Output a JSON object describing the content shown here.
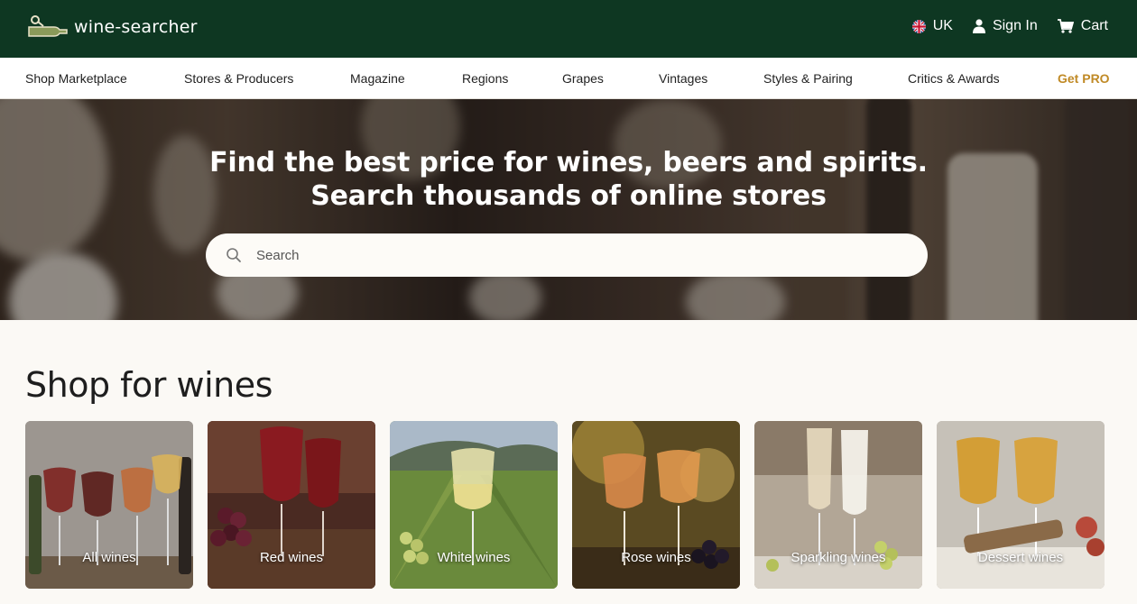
{
  "header": {
    "logo_text": "wine-searcher",
    "region": "UK",
    "sign_in": "Sign In",
    "cart": "Cart"
  },
  "nav": {
    "items": [
      {
        "label": "Shop Marketplace"
      },
      {
        "label": "Stores & Producers"
      },
      {
        "label": "Magazine"
      },
      {
        "label": "Regions"
      },
      {
        "label": "Grapes"
      },
      {
        "label": "Vintages"
      },
      {
        "label": "Styles & Pairing"
      },
      {
        "label": "Critics & Awards"
      },
      {
        "label": "Get PRO"
      }
    ]
  },
  "hero": {
    "line1": "Find the best price for wines, beers and spirits.",
    "line2": "Search thousands of online stores",
    "search_placeholder": "Search"
  },
  "section": {
    "title": "Shop for wines",
    "cards": [
      {
        "label": "All wines",
        "bg": "#8a8580"
      },
      {
        "label": "Red wines",
        "bg": "#5a2a22"
      },
      {
        "label": "White wines",
        "bg": "#6f8a4a"
      },
      {
        "label": "Rose wines",
        "bg": "#7a5a2a"
      },
      {
        "label": "Sparkling wines",
        "bg": "#a89a88"
      },
      {
        "label": "Dessert wines",
        "bg": "#b8b2a8"
      }
    ]
  },
  "colors": {
    "header_bg": "#0e3722",
    "pro_accent": "#c08a26"
  }
}
